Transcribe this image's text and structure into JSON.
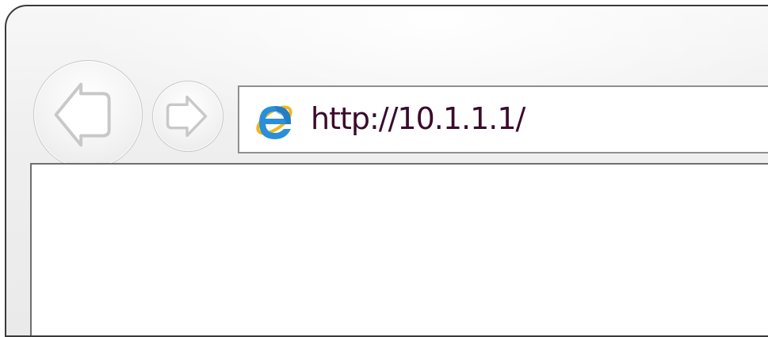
{
  "browser": {
    "nav": {
      "back_icon": "back-arrow-icon",
      "forward_icon": "forward-arrow-icon"
    },
    "address_bar": {
      "site_icon": "internet-explorer-icon",
      "url": "http://10.1.1.1/"
    },
    "colors": {
      "frame_border": "#3a3a3a",
      "url_text": "#3b0a2c",
      "ie_blue": "#2a8fd8",
      "ie_gold": "#f2b71b"
    }
  }
}
